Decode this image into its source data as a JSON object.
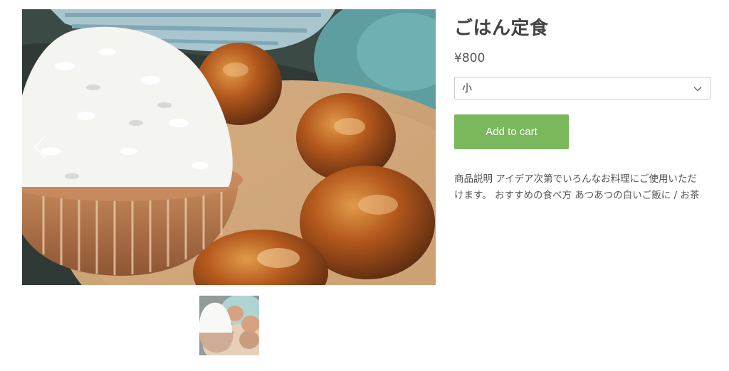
{
  "product": {
    "title": "ごはん定食",
    "price": "¥800",
    "option_selected": "小",
    "add_to_cart_label": "Add to cart",
    "description_line1": "商品説明 アイデア次第でいろんなお料理にご使用いただ",
    "description_line2": "けます。 おすすめの食べ方 あつあつの白いご飯に / お茶"
  },
  "gallery": {
    "thumbnail_count": 1
  },
  "colors": {
    "accent_button": "#79b85c",
    "title_text": "#444444"
  },
  "icons": {
    "prev": "chevron-left-icon",
    "select": "chevron-down-icon"
  }
}
